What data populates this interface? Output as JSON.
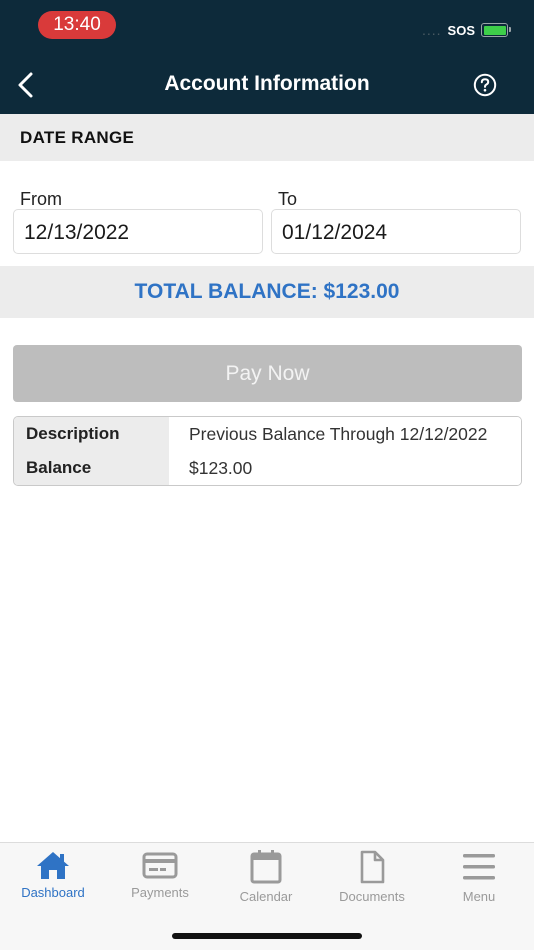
{
  "status_bar": {
    "time": "13:40",
    "dots": "....",
    "carrier": "SOS",
    "battery_level": 1.0,
    "battery_color": "#3ecf4a"
  },
  "header": {
    "title": "Account Information",
    "back_icon": "chevron-left-icon",
    "help_icon": "question-circle-icon",
    "background": "#0d2a3a"
  },
  "date_range": {
    "section_title": "DATE RANGE",
    "from_label": "From",
    "from_value": "12/13/2022",
    "to_label": "To",
    "to_value": "01/12/2024"
  },
  "total": {
    "text": "TOTAL BALANCE: $123.00",
    "color": "#2f73c5"
  },
  "pay_button": {
    "label": "Pay Now",
    "enabled": false
  },
  "details": {
    "rows": [
      {
        "label": "Description",
        "value": "Previous Balance Through 12/12/2022"
      },
      {
        "label": "Balance",
        "value": "$123.00"
      }
    ]
  },
  "tabbar": {
    "active": "Dashboard",
    "tabs": [
      {
        "label": "Dashboard",
        "icon": "home-icon"
      },
      {
        "label": "Payments",
        "icon": "credit-card-icon"
      },
      {
        "label": "Calendar",
        "icon": "calendar-icon"
      },
      {
        "label": "Documents",
        "icon": "document-icon"
      },
      {
        "label": "Menu",
        "icon": "hamburger-menu-icon"
      }
    ]
  }
}
